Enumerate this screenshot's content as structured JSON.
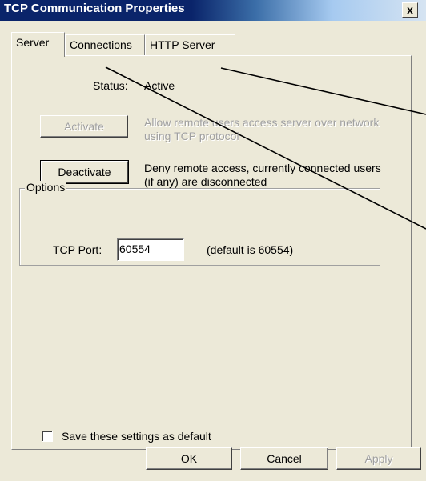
{
  "window": {
    "title": "TCP Communication Properties",
    "close_label": "x"
  },
  "tabs": [
    {
      "label": "Server",
      "active": true
    },
    {
      "label": "Connections",
      "active": false
    },
    {
      "label": "HTTP Server",
      "active": false
    }
  ],
  "server": {
    "status_label": "Status:",
    "status_value": "Active",
    "activate_label": "Activate",
    "activate_desc": "Allow remote users access server over network using TCP protocol",
    "deactivate_label": "Deactivate",
    "deactivate_desc": "Deny remote access, currently connected users (if any) are disconnected",
    "options_title": "Options",
    "tcp_port_label": "TCP Port:",
    "tcp_port_value": "60554",
    "tcp_port_hint": "(default is 60554)",
    "save_default_label": "Save these settings as default",
    "save_default_checked": false
  },
  "footer": {
    "ok_label": "OK",
    "cancel_label": "Cancel",
    "apply_label": "Apply"
  },
  "colors": {
    "dialog_bg": "#ece9d8",
    "titlebar_dark": "#0a246a",
    "disabled_text": "#a0a0a0"
  }
}
